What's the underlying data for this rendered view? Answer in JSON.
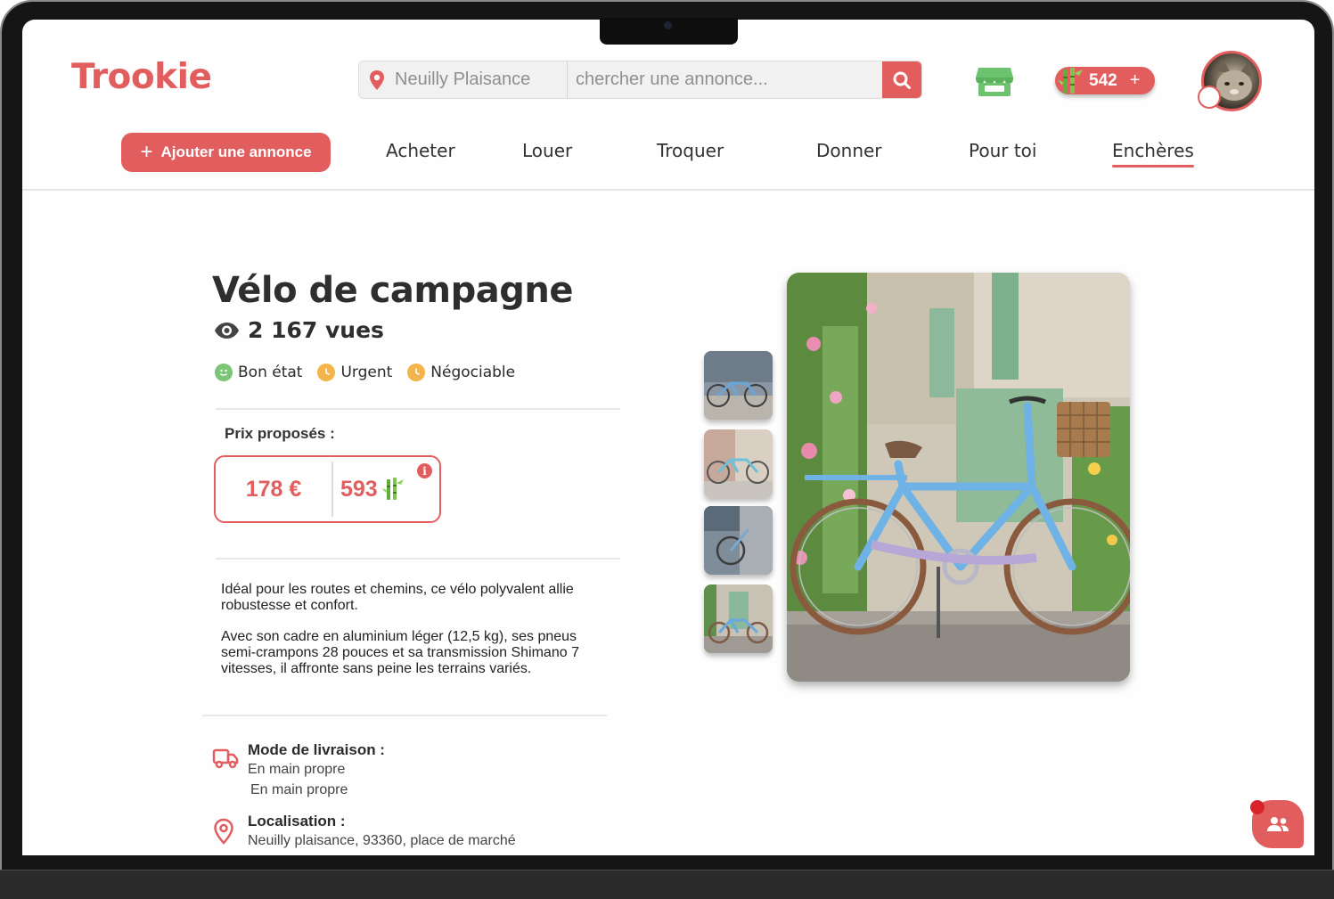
{
  "brand": {
    "name": "Trookie",
    "accent": "#e25e5e"
  },
  "header": {
    "location": "Neuilly Plaisance",
    "search_placeholder": "chercher une annonce...",
    "coins": "542",
    "coins_plus": "+"
  },
  "nav": {
    "add_label": "Ajouter une annonce",
    "items": [
      "Acheter",
      "Louer",
      "Troquer",
      "Donner",
      "Pour toi",
      "Enchères"
    ],
    "active": "Enchères"
  },
  "product": {
    "title": "Vélo de campagne",
    "views": "2 167 vues",
    "tags": [
      {
        "label": "Bon état",
        "icon": "smiley-icon",
        "color": "#7cc576"
      },
      {
        "label": "Urgent",
        "icon": "clock-icon",
        "color": "#f2b44b"
      },
      {
        "label": "Négociable",
        "icon": "clock-icon",
        "color": "#f2b44b"
      }
    ],
    "prices_label": "Prix proposés :",
    "price_eur": "178 €",
    "price_points": "593",
    "info_icon": "i",
    "description": [
      "Idéal pour les routes et chemins, ce vélo polyvalent allie robustesse et confort.",
      "Avec son cadre en aluminium léger (12,5 kg), ses pneus semi-crampons 28 pouces et sa transmission Shimano 7 vitesses, il affronte sans peine les terrains variés."
    ],
    "delivery_label": "Mode de livraison :",
    "delivery_values": [
      "En main propre",
      "En main propre"
    ],
    "location_label": "Localisation :",
    "location_value": "Neuilly plaisance, 93360, place de marché"
  }
}
